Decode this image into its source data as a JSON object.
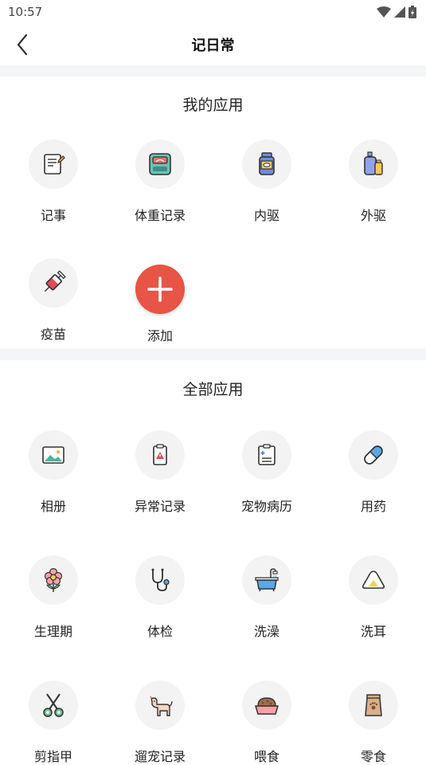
{
  "status_bar": {
    "time": "10:57"
  },
  "nav": {
    "title": "记日常"
  },
  "my_apps": {
    "title": "我的应用",
    "items": [
      {
        "label": "记事",
        "icon": "notepad-icon"
      },
      {
        "label": "体重记录",
        "icon": "scale-icon"
      },
      {
        "label": "内驱",
        "icon": "medicine-bottle-icon"
      },
      {
        "label": "外驱",
        "icon": "spray-bottle-icon"
      },
      {
        "label": "疫苗",
        "icon": "syringe-icon"
      }
    ],
    "add_label": "添加"
  },
  "all_apps": {
    "title": "全部应用",
    "items": [
      {
        "label": "相册",
        "icon": "photo-icon"
      },
      {
        "label": "异常记录",
        "icon": "warning-clipboard-icon"
      },
      {
        "label": "宠物病历",
        "icon": "medical-record-icon"
      },
      {
        "label": "用药",
        "icon": "pill-icon"
      },
      {
        "label": "生理期",
        "icon": "flower-icon"
      },
      {
        "label": "体检",
        "icon": "stethoscope-icon"
      },
      {
        "label": "洗澡",
        "icon": "bathtub-icon"
      },
      {
        "label": "洗耳",
        "icon": "ear-icon"
      },
      {
        "label": "剪指甲",
        "icon": "scissors-icon"
      },
      {
        "label": "遛宠记录",
        "icon": "dog-icon"
      },
      {
        "label": "喂食",
        "icon": "food-bowl-icon"
      },
      {
        "label": "零食",
        "icon": "snack-bag-icon"
      }
    ]
  }
}
